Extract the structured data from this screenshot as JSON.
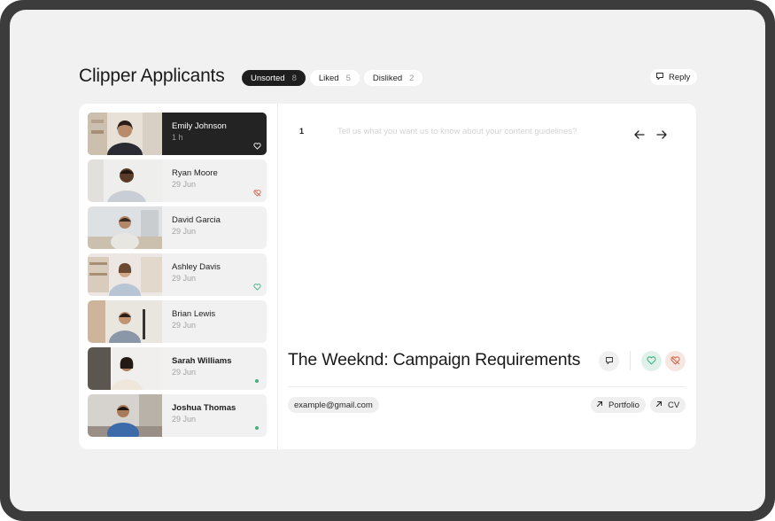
{
  "app": {
    "title": "Clipper Applicants"
  },
  "filters": [
    {
      "label": "Unsorted",
      "count": "8",
      "active": true
    },
    {
      "label": "Liked",
      "count": "5",
      "active": false
    },
    {
      "label": "Disliked",
      "count": "2",
      "active": false
    }
  ],
  "reply": {
    "label": "Reply",
    "icon": "comment-icon"
  },
  "applicants": [
    {
      "name": "Emily Johnson",
      "date": "1 h",
      "status": "heart-outline",
      "bold": false,
      "active": true
    },
    {
      "name": "Ryan Moore",
      "date": "29 Jun",
      "status": "heart-broken",
      "bold": false,
      "active": false
    },
    {
      "name": "David Garcia",
      "date": "29 Jun",
      "status": "none",
      "bold": false,
      "active": false
    },
    {
      "name": "Ashley Davis",
      "date": "29 Jun",
      "status": "heart-liked",
      "bold": false,
      "active": false
    },
    {
      "name": "Brian Lewis",
      "date": "29 Jun",
      "status": "none",
      "bold": false,
      "active": false
    },
    {
      "name": "Sarah Williams",
      "date": "29 Jun",
      "status": "unread-dot",
      "bold": true,
      "active": false
    },
    {
      "name": "Joshua Thomas",
      "date": "29 Jun",
      "status": "unread-dot",
      "bold": true,
      "active": false
    }
  ],
  "detail": {
    "question_number": "1",
    "question_placeholder": "Tell us what you want us to know about your content guidelines?",
    "campaign_title": "The Weeknd: Campaign Requirements",
    "email": "example@gmail.com",
    "links": [
      {
        "label": "Portfolio",
        "icon": "arrow-up-right-icon"
      },
      {
        "label": "CV",
        "icon": "arrow-up-right-icon"
      }
    ]
  },
  "colors": {
    "active_pill": "#1e1e1e",
    "liked": "#3fb27f",
    "disliked": "#d46a4c",
    "background": "#f1f1f1"
  }
}
